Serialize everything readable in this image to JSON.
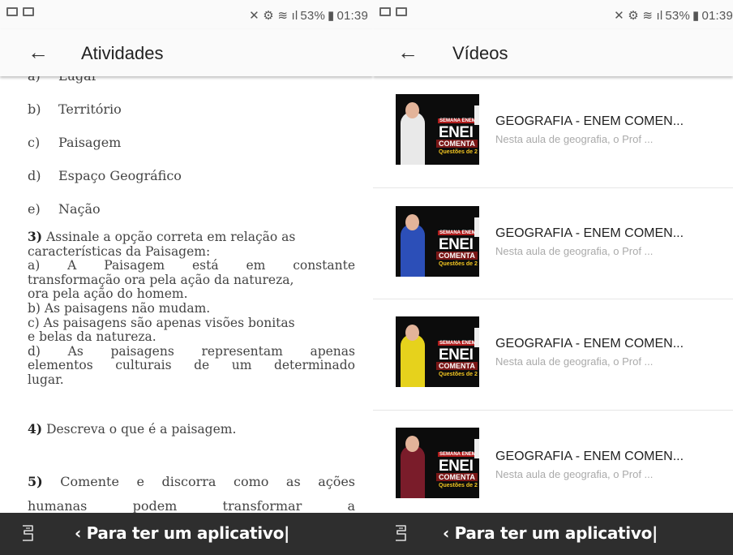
{
  "status_bar": {
    "battery": "53%",
    "time": "01:39"
  },
  "left_screen": {
    "title": "Atividades",
    "options_top": [
      {
        "letter": "a)",
        "text": "Lugar"
      },
      {
        "letter": "b)",
        "text": "Território"
      },
      {
        "letter": "c)",
        "text": "Paisagem"
      },
      {
        "letter": "d)",
        "text": "Espaço Geográfico"
      },
      {
        "letter": "e)",
        "text": "Nação"
      }
    ],
    "q3": {
      "number": "3)",
      "lines": [
        "Assinale a opção correta em relação as",
        "características da Paisagem:",
        "a) A Paisagem está em constante",
        "transformação ora pela ação da natureza,",
        "ora pela ação do homem.",
        "b) As paisagens não mudam.",
        "c) As paisagens são apenas visões bonitas",
        "e belas da natureza.",
        "d) As paisagens representam apenas",
        "elementos culturais de um determinado",
        "lugar."
      ]
    },
    "q4": {
      "number": "4)",
      "text": "Descreva o que é a paisagem."
    },
    "q5": {
      "number": "5)",
      "line1": "Comente e discorra como as ações",
      "line2_words": [
        "humanas",
        "podem",
        "transformar",
        "a"
      ]
    }
  },
  "right_screen": {
    "title": "Vídeos",
    "videos": [
      {
        "title": "GEOGRAFIA - ENEM COMEN...",
        "description": "Nesta aula de geografia, o Prof ...",
        "shirt_color": "#e9e9e9"
      },
      {
        "title": "GEOGRAFIA - ENEM COMEN...",
        "description": "Nesta aula de geografia, o Prof ...",
        "shirt_color": "#2c4fb8"
      },
      {
        "title": "GEOGRAFIA - ENEM COMEN...",
        "description": "Nesta aula de geografia, o Prof ...",
        "shirt_color": "#e6d21c"
      },
      {
        "title": "GEOGRAFIA - ENEM COMEN...",
        "description": "Nesta aula de geografia, o Prof ...",
        "shirt_color": "#7a1c2a"
      }
    ],
    "thumb_text": {
      "top": "SEMANA ENEM",
      "main": "ENEI",
      "sub": "COMENTA",
      "bottom": "Questões de 2"
    }
  },
  "banner": {
    "text": "‹ Para ter um aplicativo|"
  }
}
